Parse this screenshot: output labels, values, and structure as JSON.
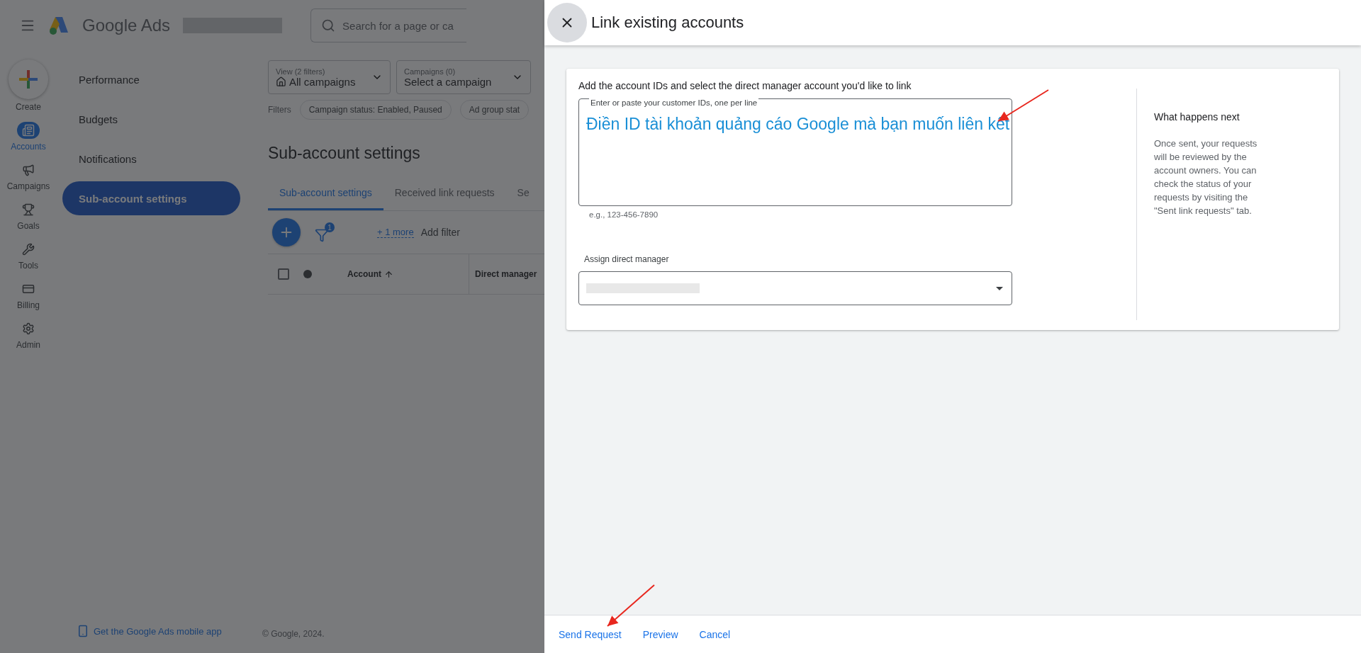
{
  "app": {
    "name": "Google Ads",
    "search_placeholder": "Search for a page or ca"
  },
  "create_button": {
    "label": "Create"
  },
  "rail": [
    {
      "label": "Accounts",
      "selected": true
    },
    {
      "label": "Campaigns",
      "selected": false
    },
    {
      "label": "Goals",
      "selected": false
    },
    {
      "label": "Tools",
      "selected": false
    },
    {
      "label": "Billing",
      "selected": false
    },
    {
      "label": "Admin",
      "selected": false
    }
  ],
  "sidebar": {
    "items": [
      {
        "label": "Performance",
        "selected": false
      },
      {
        "label": "Budgets",
        "selected": false
      },
      {
        "label": "Notifications",
        "selected": false
      },
      {
        "label": "Sub-account settings",
        "selected": true
      }
    ],
    "mobile_link": "Get the Google Ads mobile app"
  },
  "selectors": [
    {
      "label": "View (2 filters)",
      "value": "All campaigns"
    },
    {
      "label": "Campaigns (0)",
      "value": "Select a campaign"
    }
  ],
  "filters": {
    "label": "Filters",
    "chips": [
      "Campaign status: Enabled, Paused",
      "Ad group stat"
    ]
  },
  "page_title": "Sub-account settings",
  "tabs": [
    {
      "label": "Sub-account settings",
      "selected": true
    },
    {
      "label": "Received link requests",
      "selected": false
    },
    {
      "label": "Se",
      "selected": false
    }
  ],
  "toolbar": {
    "filter_count": "1",
    "more_link": "+ 1 more",
    "add_filter": "Add filter"
  },
  "table": {
    "select_all": {
      "checked": false
    },
    "columns": [
      "Account",
      "Direct manager"
    ]
  },
  "copyright": "© Google, 2024.",
  "dialog": {
    "title": "Link existing accounts",
    "instruction": "Add the account IDs and select the direct manager account you'd like to link",
    "ids_field": {
      "label": "Enter or paste your customer IDs, one per line",
      "value": "Điền ID tài khoản quảng cáo Google mà bạn muốn liên kết",
      "hint": "e.g., 123-456-7890"
    },
    "manager_field": {
      "label": "Assign direct manager"
    },
    "side_heading": "What happens next",
    "side_text": "Once sent, your requests will be reviewed by the account owners. You can check the status of your requests by visiting the \"Sent link requests\" tab.",
    "actions": [
      "Send Request",
      "Preview",
      "Cancel"
    ]
  }
}
